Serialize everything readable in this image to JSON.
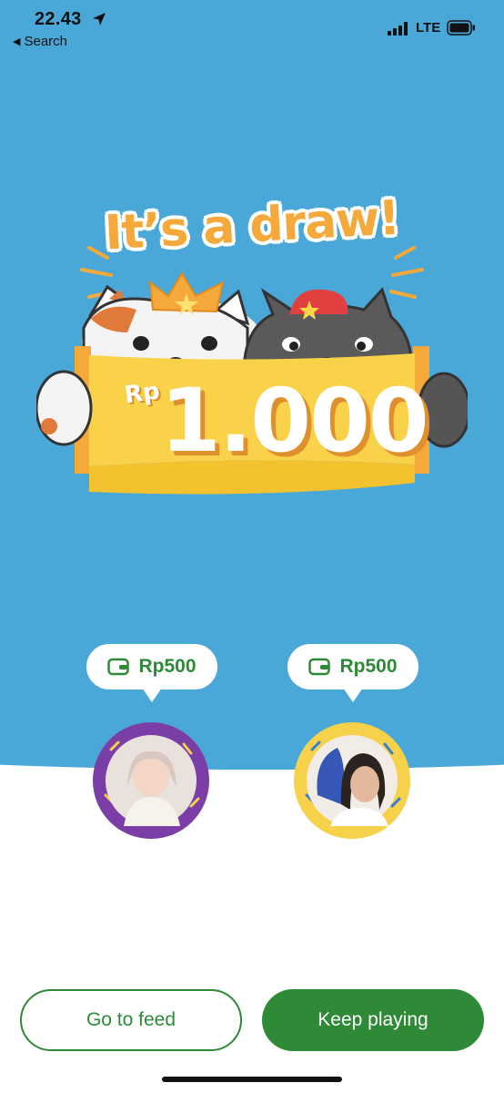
{
  "status_bar": {
    "time": "22.43",
    "back_label": "Search",
    "network": "LTE"
  },
  "result": {
    "title": "It’s a draw!",
    "prize_currency": "Rp",
    "prize_amount": "1.000"
  },
  "players": [
    {
      "wallet_amount": "Rp500",
      "avatar_ring_color": "#7b3ea6"
    },
    {
      "wallet_amount": "Rp500",
      "avatar_ring_color": "#f6d24a"
    }
  ],
  "actions": {
    "go_to_feed": "Go to feed",
    "keep_playing": "Keep playing"
  },
  "colors": {
    "background": "#4aa8d8",
    "brand_green": "#2e8a37",
    "accent_orange": "#f4a93a",
    "banner_yellow": "#f9d24a"
  }
}
